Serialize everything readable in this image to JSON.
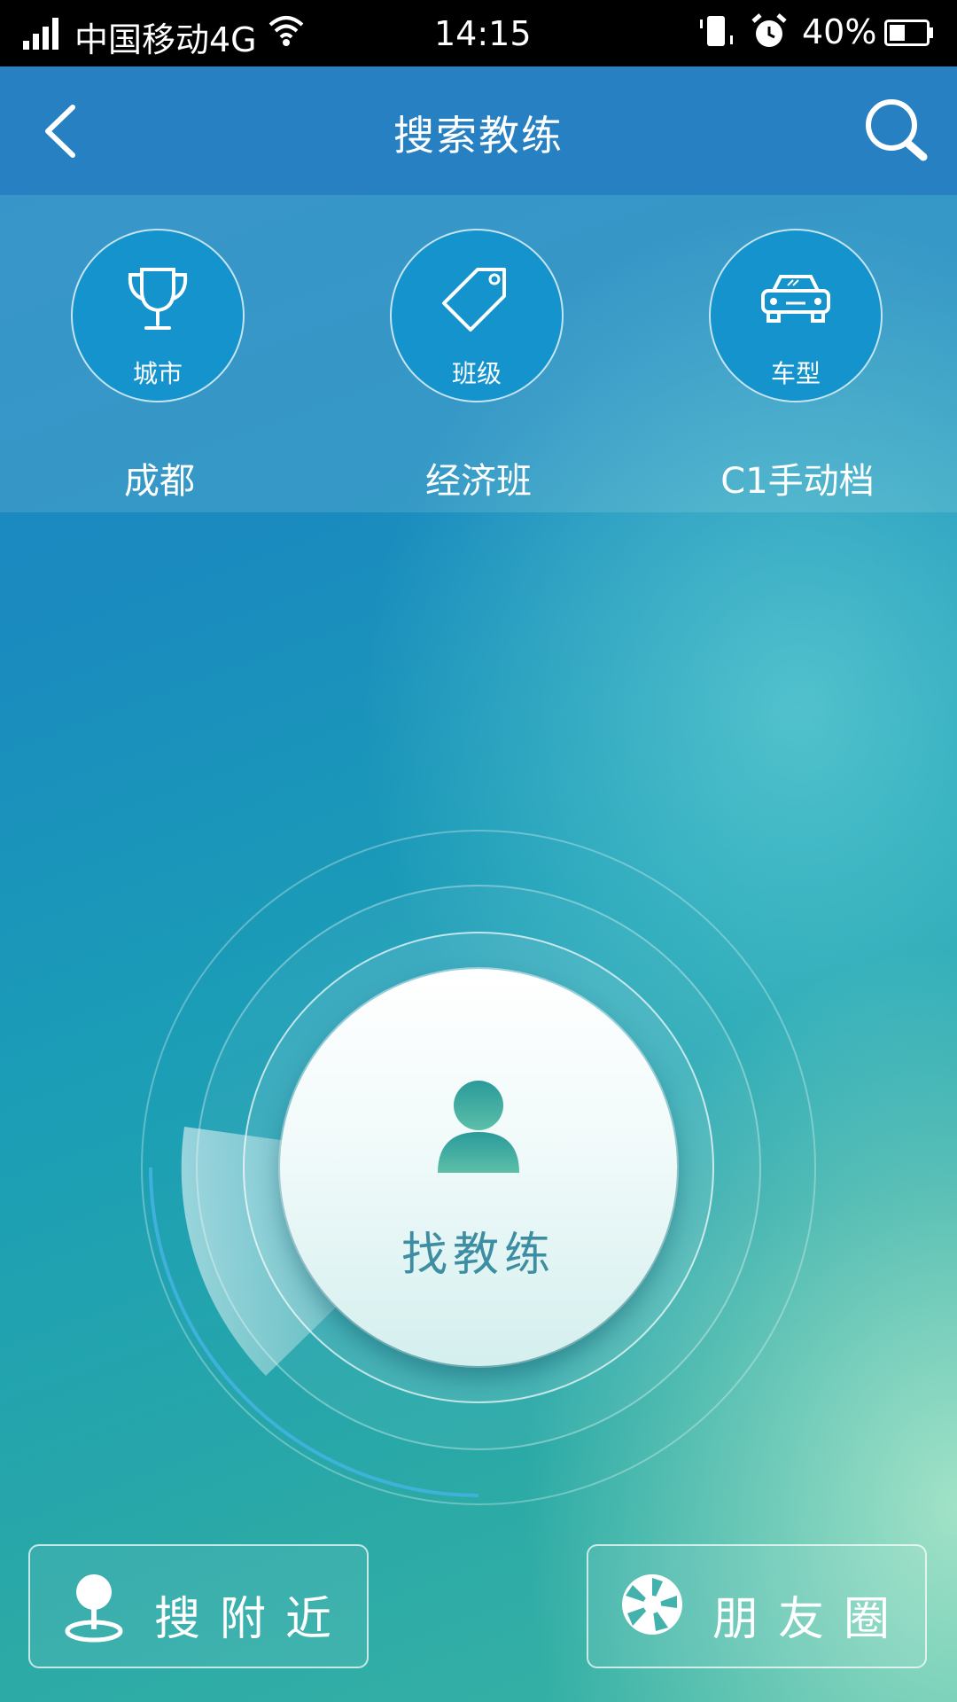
{
  "status_bar": {
    "carrier": "中国移动4G",
    "time": "14:15",
    "battery": "40%"
  },
  "header": {
    "title": "搜索教练"
  },
  "filters": [
    {
      "icon": "trophy-icon",
      "label": "城市",
      "value": "成都"
    },
    {
      "icon": "tag-icon",
      "label": "班级",
      "value": "经济班"
    },
    {
      "icon": "car-icon",
      "label": "车型",
      "value": "C1手动档"
    }
  ],
  "radar": {
    "button_label": "找教练",
    "icon": "person-icon"
  },
  "bottom": {
    "nearby_label": "搜附近",
    "nearby_icon": "location-pin-icon",
    "moments_label": "朋友圈",
    "moments_icon": "aperture-icon"
  },
  "colors": {
    "header": "#2780c2",
    "filter_circle": "#1493cc",
    "find_label": "#3d8ea2"
  }
}
